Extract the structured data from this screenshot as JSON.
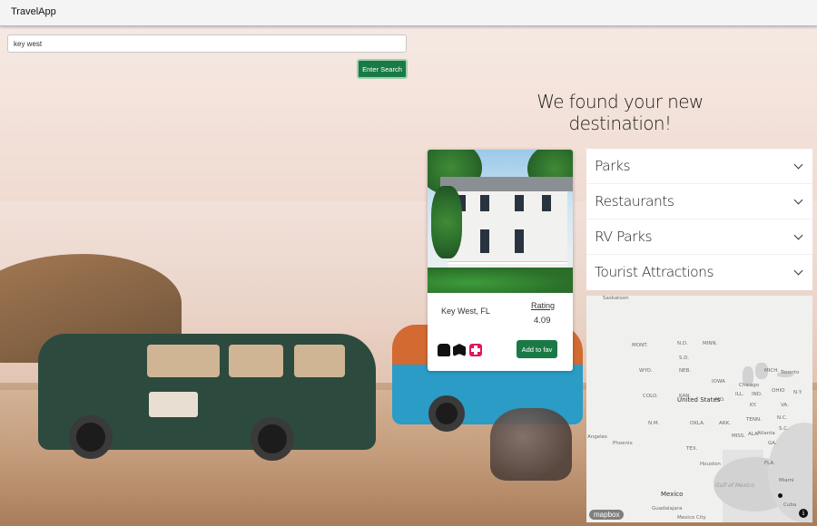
{
  "app": {
    "title": "TravelApp"
  },
  "search": {
    "value": "key west",
    "button_label": "Enter Search"
  },
  "headline": "We found your new destination!",
  "destination": {
    "city": "Key West, FL",
    "rating_label": "Rating",
    "rating_value": "4.09",
    "amenity_icons": [
      "bus-icon",
      "book-icon",
      "first-aid-icon"
    ],
    "fav_button_label": "Add to fav"
  },
  "categories": [
    {
      "label": "Parks"
    },
    {
      "label": "Restaurants"
    },
    {
      "label": "RV Parks"
    },
    {
      "label": "Tourist Attractions"
    }
  ],
  "map": {
    "labels": [
      "Saskatoon",
      "MONT.",
      "N.D.",
      "MINN.",
      "WYO.",
      "S.D.",
      "NEB.",
      "IOWA",
      "Chicago",
      "MICH.",
      "Toronto",
      "ILL.",
      "IND.",
      "OHIO",
      "N.Y.",
      "COLO.",
      "KAN.",
      "MO.",
      "KY.",
      "VA.",
      "United States",
      "N.M.",
      "OKLA.",
      "ARK.",
      "TENN.",
      "N.C.",
      "S.C.",
      "ALA.",
      "MISS.",
      "Atlanta",
      "GA.",
      "Angeles",
      "Phoenix",
      "TEX.",
      "Houston",
      "FLA.",
      "Gulf of Mexico",
      "Miami",
      "Mexico",
      "Cuba",
      "Guadalajara",
      "Mexico City"
    ],
    "attribution": "mapbox"
  },
  "colors": {
    "accent_green": "#1a7a46",
    "aid_pink": "#e3165b"
  }
}
